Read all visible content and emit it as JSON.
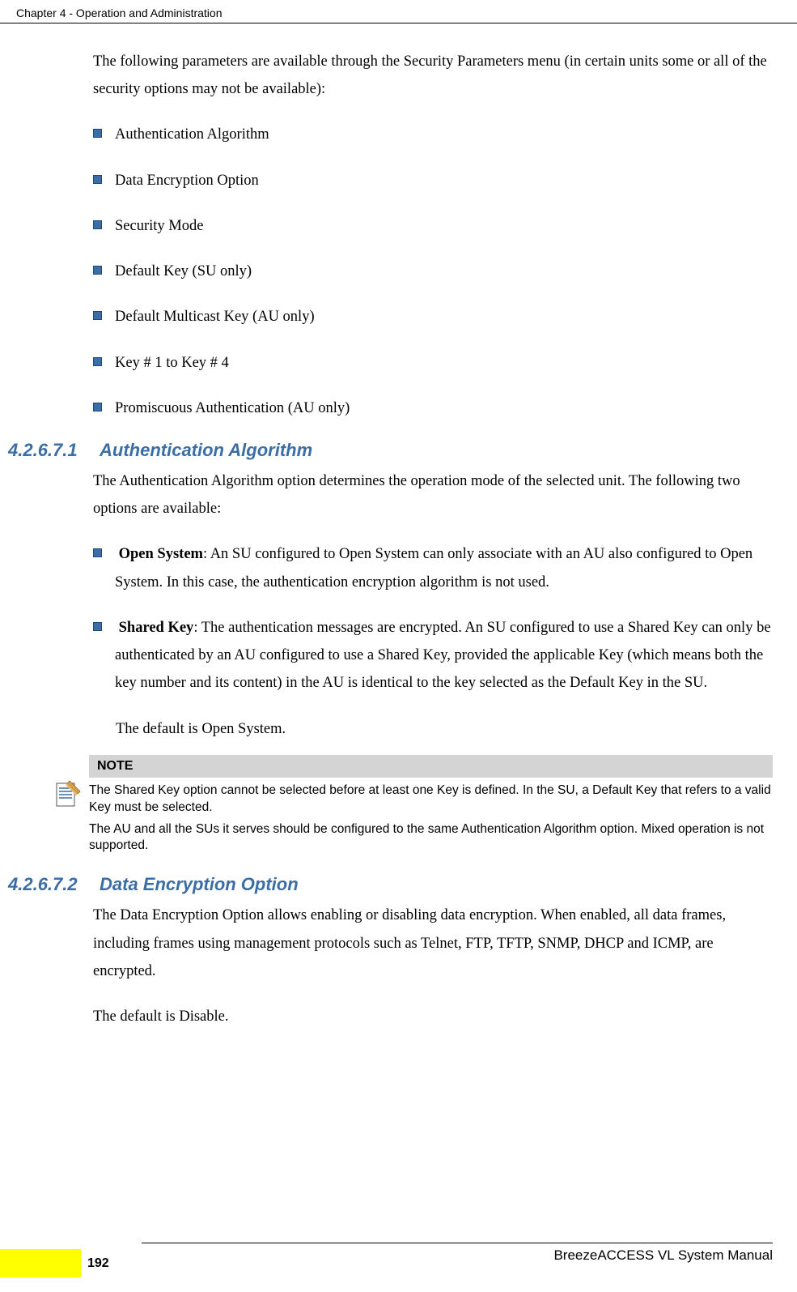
{
  "header": {
    "chapter_title": "Chapter 4 - Operation and Administration"
  },
  "intro": "The following parameters are available through the Security Parameters menu (in certain units some or all of the security options may not be available):",
  "bullets_top": [
    "Authentication Algorithm",
    "Data Encryption Option",
    "Security Mode",
    "Default Key (SU only)",
    "Default Multicast Key (AU only)",
    "Key # 1 to Key # 4",
    "Promiscuous Authentication (AU only)"
  ],
  "section1": {
    "number": "4.2.6.7.1",
    "title": "Authentication Algorithm",
    "intro": "The Authentication Algorithm option determines the operation mode of the selected unit. The following two options are available:",
    "options": [
      {
        "label": "Open System",
        "desc": ": An SU configured to Open System can only associate with an AU also configured to Open System. In this case, the authentication encryption algorithm is not used."
      },
      {
        "label": "Shared Key",
        "desc": ": The authentication messages are encrypted. An SU configured to use a Shared Key can only be authenticated by an AU configured to use a Shared Key, provided the applicable Key (which means both the key number and its content) in the AU is identical to the key selected as the Default Key in the SU."
      }
    ],
    "default": "The default is Open System."
  },
  "note": {
    "header": "NOTE",
    "line1": "The Shared Key option cannot be selected before at least one Key is defined. In the SU, a Default Key that refers to a valid Key must be selected.",
    "line2": "The AU and all the SUs it serves should be configured to the same Authentication Algorithm option. Mixed operation is not supported."
  },
  "section2": {
    "number": "4.2.6.7.2",
    "title": "Data Encryption Option",
    "para1": "The Data Encryption Option allows enabling or disabling data encryption. When enabled, all data frames, including frames using management protocols such as Telnet, FTP, TFTP, SNMP, DHCP and ICMP, are encrypted.",
    "para2": "The default is Disable."
  },
  "footer": {
    "manual": "BreezeACCESS VL System Manual",
    "page": "192"
  }
}
